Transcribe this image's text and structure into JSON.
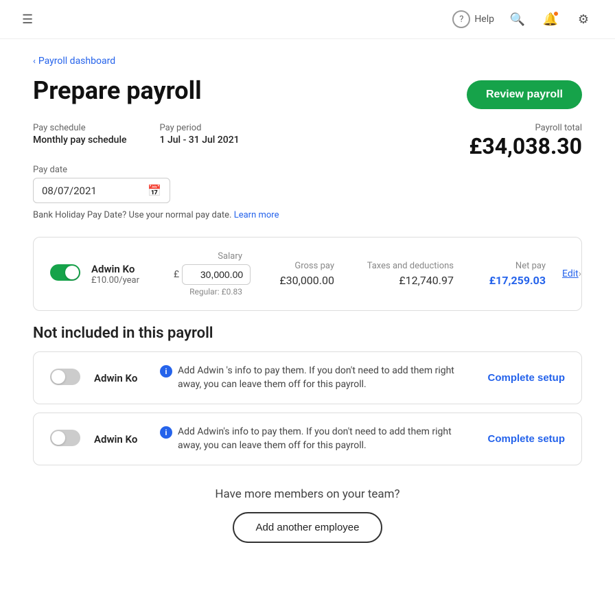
{
  "header": {
    "help_label": "Help",
    "icons": {
      "search": "🔍",
      "notification": "🔔",
      "settings": "⚙"
    }
  },
  "breadcrumb": {
    "text": "Payroll dashboard"
  },
  "page": {
    "title": "Prepare payroll",
    "review_button": "Review payroll"
  },
  "pay_info": {
    "schedule_label": "Pay schedule",
    "schedule_value": "Monthly pay schedule",
    "period_label": "Pay period",
    "period_value": "1 Jul - 31 Jul 2021",
    "date_label": "Pay date",
    "date_value": "08/07/2021",
    "total_label": "Payroll total",
    "total_value": "£34,038.30"
  },
  "bank_holiday": {
    "text": "Bank Holiday Pay Date? Use your normal pay date.",
    "link": "Learn more"
  },
  "included_employee": {
    "name": "Adwin Ko",
    "sub": "£10.00/year",
    "salary_header": "Salary",
    "salary_currency": "£",
    "salary_value": "30,000.00",
    "salary_regular": "Regular: £0.83",
    "gross_pay_header": "Gross pay",
    "gross_pay_value": "£30,000.00",
    "taxes_header": "Taxes and deductions",
    "taxes_value": "£12,740.97",
    "net_pay_header": "Net pay",
    "net_pay_value": "£17,259.03",
    "edit_link": "Edit"
  },
  "not_included_section": {
    "title": "Not included in this payroll",
    "employees": [
      {
        "name": "Adwin Ko",
        "message": "Add Adwin 's info to pay them. If you don't need to add them right away, you can leave them off for this payroll.",
        "button": "Complete setup"
      },
      {
        "name": "Adwin Ko",
        "message": "Add Adwin's info to pay them. If you don't need to add them right away, you can leave them off for this payroll.",
        "button": "Complete setup"
      }
    ]
  },
  "bottom_cta": {
    "text": "Have more members on your team?",
    "button": "Add another employee"
  }
}
